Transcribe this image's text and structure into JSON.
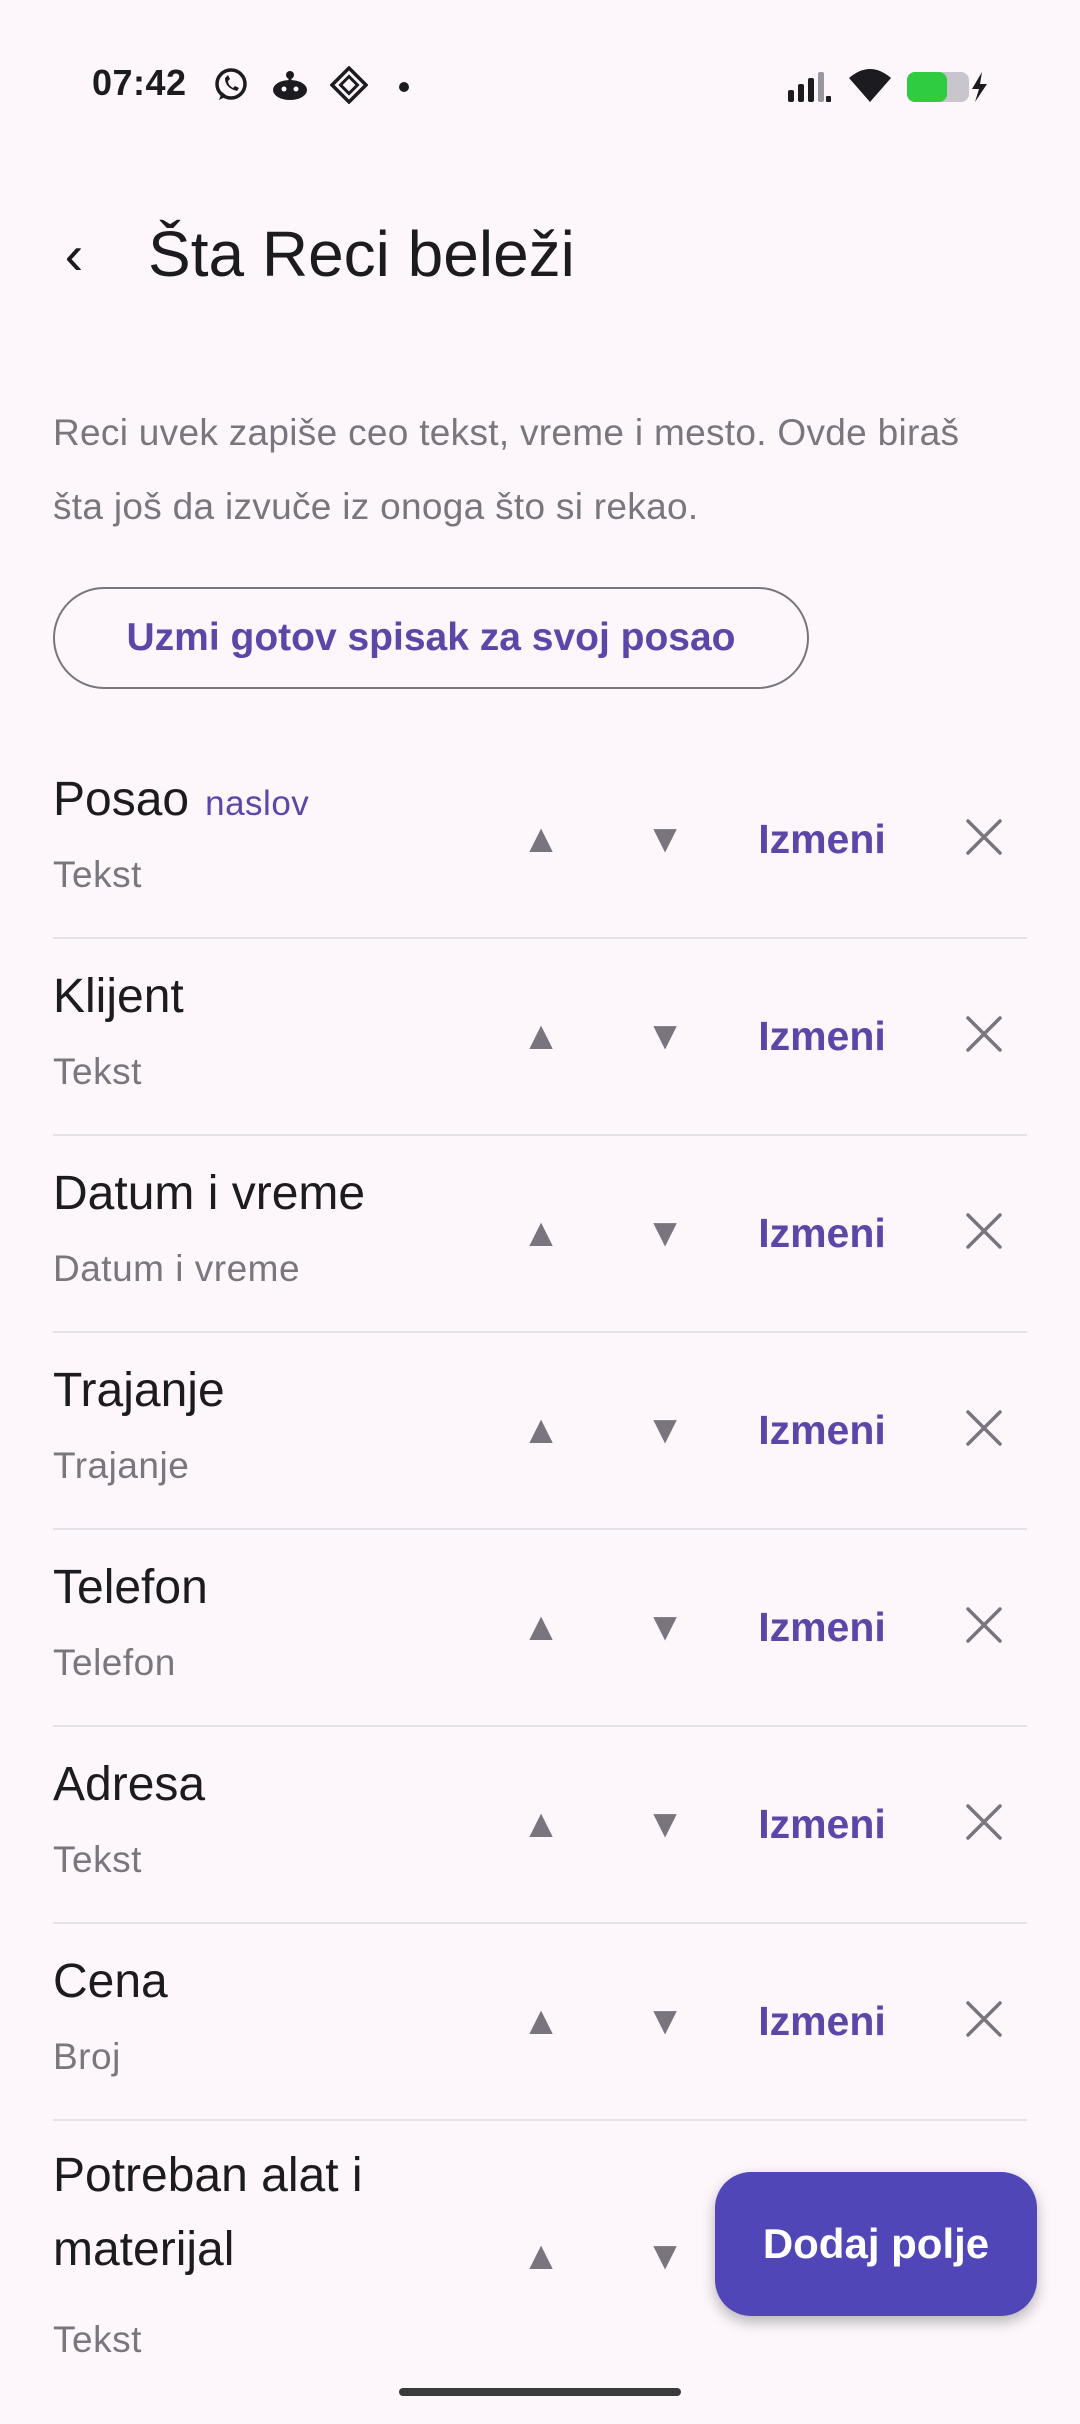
{
  "status_bar": {
    "time": "07:42",
    "left_icons": [
      "whatsapp-icon",
      "app-icon",
      "app-icon-diamond",
      "notification-dot-icon"
    ],
    "right_icons": [
      "signal-icon",
      "wifi-icon",
      "battery-charging-icon"
    ],
    "battery_color": "#2ecc40"
  },
  "header": {
    "back_label": "‹",
    "title": "Šta Reci beleži"
  },
  "description": "Reci uvek zapiše ceo tekst, vreme i mesto. Ovde biraš šta još da izvuče iz onoga što si rekao.",
  "preset_button": {
    "label": "Uzmi gotov spisak za svoj posao"
  },
  "controls": {
    "up": "▲",
    "down": "▼",
    "edit": "Izmeni"
  },
  "fields": [
    {
      "name": "Posao",
      "badge": "naslov",
      "type": "Tekst"
    },
    {
      "name": "Klijent",
      "badge": "",
      "type": "Tekst"
    },
    {
      "name": "Datum i vreme",
      "badge": "",
      "type": "Datum i vreme"
    },
    {
      "name": "Trajanje",
      "badge": "",
      "type": "Trajanje"
    },
    {
      "name": "Telefon",
      "badge": "",
      "type": "Telefon"
    },
    {
      "name": "Adresa",
      "badge": "",
      "type": "Tekst"
    },
    {
      "name": "Cena",
      "badge": "",
      "type": "Broj"
    },
    {
      "name": "Potreban alat i materijal",
      "badge": "",
      "type": "Tekst"
    }
  ],
  "fab": {
    "label": "Dodaj polje"
  },
  "colors": {
    "accent": "#5c46a8",
    "fab": "#5046b8",
    "background": "#fdf7fc"
  }
}
